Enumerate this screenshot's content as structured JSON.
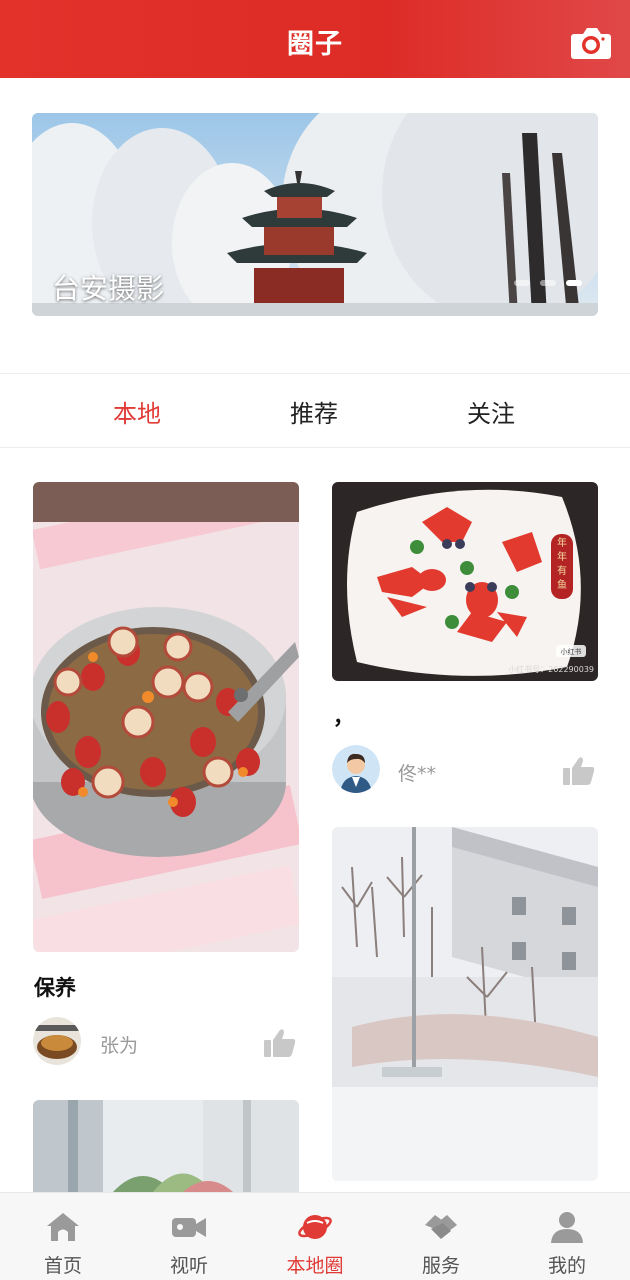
{
  "header": {
    "title": "圈子",
    "camera_icon": "camera-icon"
  },
  "banner": {
    "caption": "台安摄影",
    "dot_count": 3,
    "active_dot": 3
  },
  "tabs": [
    {
      "label": "本地",
      "active": true
    },
    {
      "label": "推荐",
      "active": false
    },
    {
      "label": "关注",
      "active": false
    }
  ],
  "feed": {
    "left": [
      {
        "title": "保养",
        "author": "张为",
        "image": "soup-pot-photo",
        "like_icon": "thumbs-up-icon"
      },
      {
        "image": "window-plant-photo"
      }
    ],
    "right": [
      {
        "title": "，",
        "author": "佟**",
        "image": "strawberry-goldfish-plate-photo",
        "like_icon": "thumbs-up-icon",
        "image_texts": {
          "badge": "年年有鱼",
          "watermark_brand": "小红书",
          "watermark_id": "小红书号：262290039"
        }
      },
      {
        "image": "snowy-courtyard-photo"
      }
    ]
  },
  "bottom_nav": [
    {
      "label": "首页",
      "icon": "home-icon",
      "active": false
    },
    {
      "label": "视听",
      "icon": "video-camera-icon",
      "active": false
    },
    {
      "label": "本地圈",
      "icon": "planet-icon",
      "active": true
    },
    {
      "label": "服务",
      "icon": "handshake-icon",
      "active": false
    },
    {
      "label": "我的",
      "icon": "user-icon",
      "active": false
    }
  ],
  "colors": {
    "brand_red": "#e03b36",
    "header_red": "#e2322a",
    "muted_text": "#999999",
    "icon_gray": "#9a9a9a"
  }
}
